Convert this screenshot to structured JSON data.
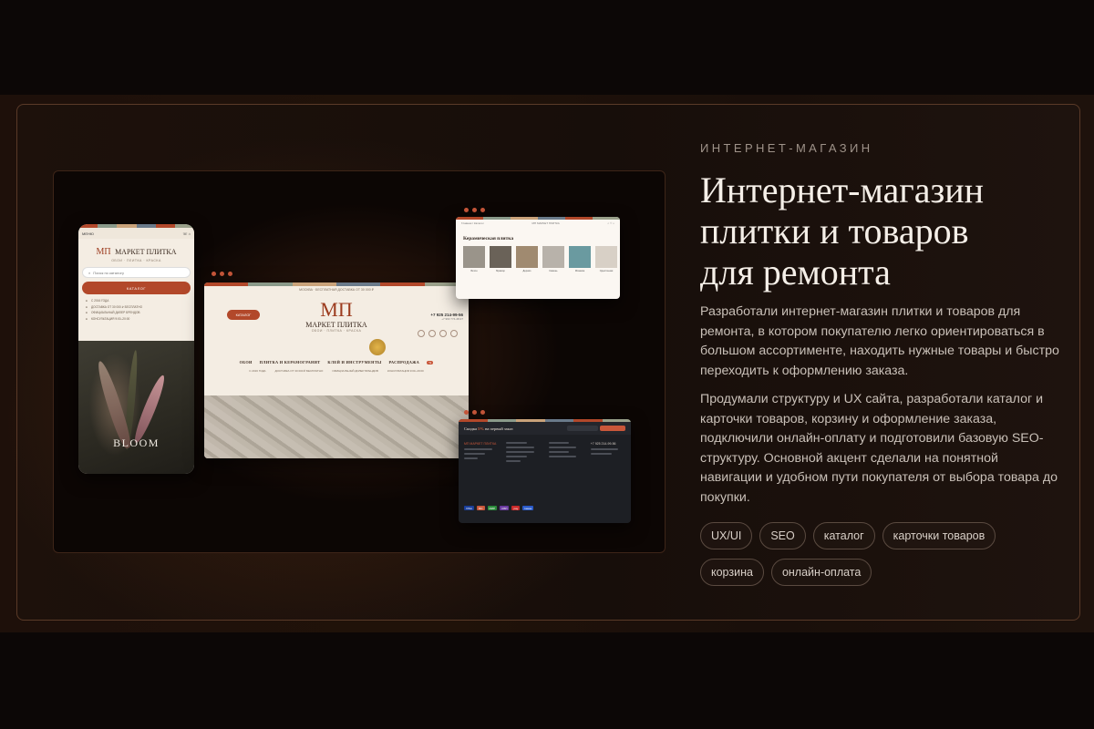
{
  "project": {
    "eyebrow": "ИНТЕРНЕТ-МАГАЗИН",
    "title_lines": [
      "Интернет-магазин",
      "плитки и товаров",
      "для ремонта"
    ],
    "paragraph_1": "Разработали интернет-магазин плитки и товаров для ремонта, в котором покупателю легко ориентироваться в большом ассортименте, находить нужные товары и быстро переходить к оформлению заказа.",
    "paragraph_2": "Продумали структуру и UX сайта, разработали каталог и карточки товаров, корзину и оформление заказа, подключили онлайн-оплату и подготовили базовую SEO-структуру. Основной акцент сделали на понятной навигации и удобном пути покупателя от выбора товара до покупки.",
    "tags": [
      "UX/UI",
      "SEO",
      "каталог",
      "карточки товаров",
      "корзина",
      "онлайн-оплата"
    ]
  },
  "mockups": {
    "stripe_colors": [
      "#b2482a",
      "#8a9a8a",
      "#c9a27a",
      "#6a7a8a",
      "#b2482a",
      "#9aa08a"
    ],
    "phone": {
      "menu_label": "МЕНЮ",
      "logo": "МП",
      "brand_name": "МАРКЕТ ПЛИТКА",
      "brand_sub": "ОБОИ · ПЛИТКА · КРАСКА",
      "search_placeholder": "Поиск по каталогу",
      "catalog_button": "КАТАЛОГ",
      "info_lines": [
        "С 2016 ГОДА",
        "ДОСТАВКА ОТ 30 000 ₽ БЕСПЛАТНО",
        "ОФИЦИАЛЬНЫЙ ДИЛЕР БРЕНДОВ",
        "КОНСУЛЬТАЦИЯ 9:00–20:00"
      ],
      "photo_caption": "BLOOM"
    },
    "desktop": {
      "notice": "МОСКВА · БЕСПЛАТНАЯ ДОСТАВКА ОТ 30 000 ₽",
      "catalog_button": "КАТАЛОГ",
      "logo": "МП",
      "brand_name": "МАРКЕТ ПЛИТКА",
      "brand_sub": "ОБОИ · ПЛИТКА · КРАСКА",
      "phone_main": "+7 925 214-99-56",
      "phone_alt": "+7 963 774-48-97",
      "nav": [
        "ОБОИ",
        "ПЛИТКА И КЕРАМОГРАНИТ",
        "КЛЕЙ И ИНСТРУМЕНТЫ",
        "РАСПРОДАЖА"
      ],
      "sale_badge": "%",
      "features": [
        "С 2016 ГОДА",
        "ДОСТАВКА ОТ 30 000 ₽ БЕСПЛАТНО",
        "ОФИЦИАЛЬНЫЙ ДИЛЕР БРЕНДОВ",
        "КОНСУЛЬТАЦИЯ 9:00–20:00"
      ]
    },
    "tiles": {
      "header_left": "Главная / Каталог",
      "header_center": "МП МАРКЕТ ПЛИТКА",
      "title": "Керамическая плитка",
      "items": [
        {
          "label": "Бетон",
          "color": "#9a948a"
        },
        {
          "label": "Мрамор",
          "color": "#6a6258"
        },
        {
          "label": "Дерево",
          "color": "#a08a70"
        },
        {
          "label": "Камень",
          "color": "#b8b2aa"
        },
        {
          "label": "Мозаика",
          "color": "#6a9aa0"
        },
        {
          "label": "Однотонная",
          "color": "#d8d0c6"
        }
      ]
    },
    "footer": {
      "promo_prefix": "Скидка ",
      "promo_discount": "5%",
      "promo_suffix": " на первый заказ",
      "brand": "МП МАРКЕТ ПЛИТКА",
      "footer_phone": "+7 925 214-99-56",
      "payments": [
        {
          "label": "VISA",
          "color": "#1a3e9a"
        },
        {
          "label": "MC",
          "color": "#c9573a"
        },
        {
          "label": "МИР",
          "color": "#2a8a3a"
        },
        {
          "label": "СБП",
          "color": "#6a3aa0"
        },
        {
          "label": "pay",
          "color": "#c92a2a"
        },
        {
          "label": "kassa",
          "color": "#2a5ac9"
        }
      ]
    }
  }
}
